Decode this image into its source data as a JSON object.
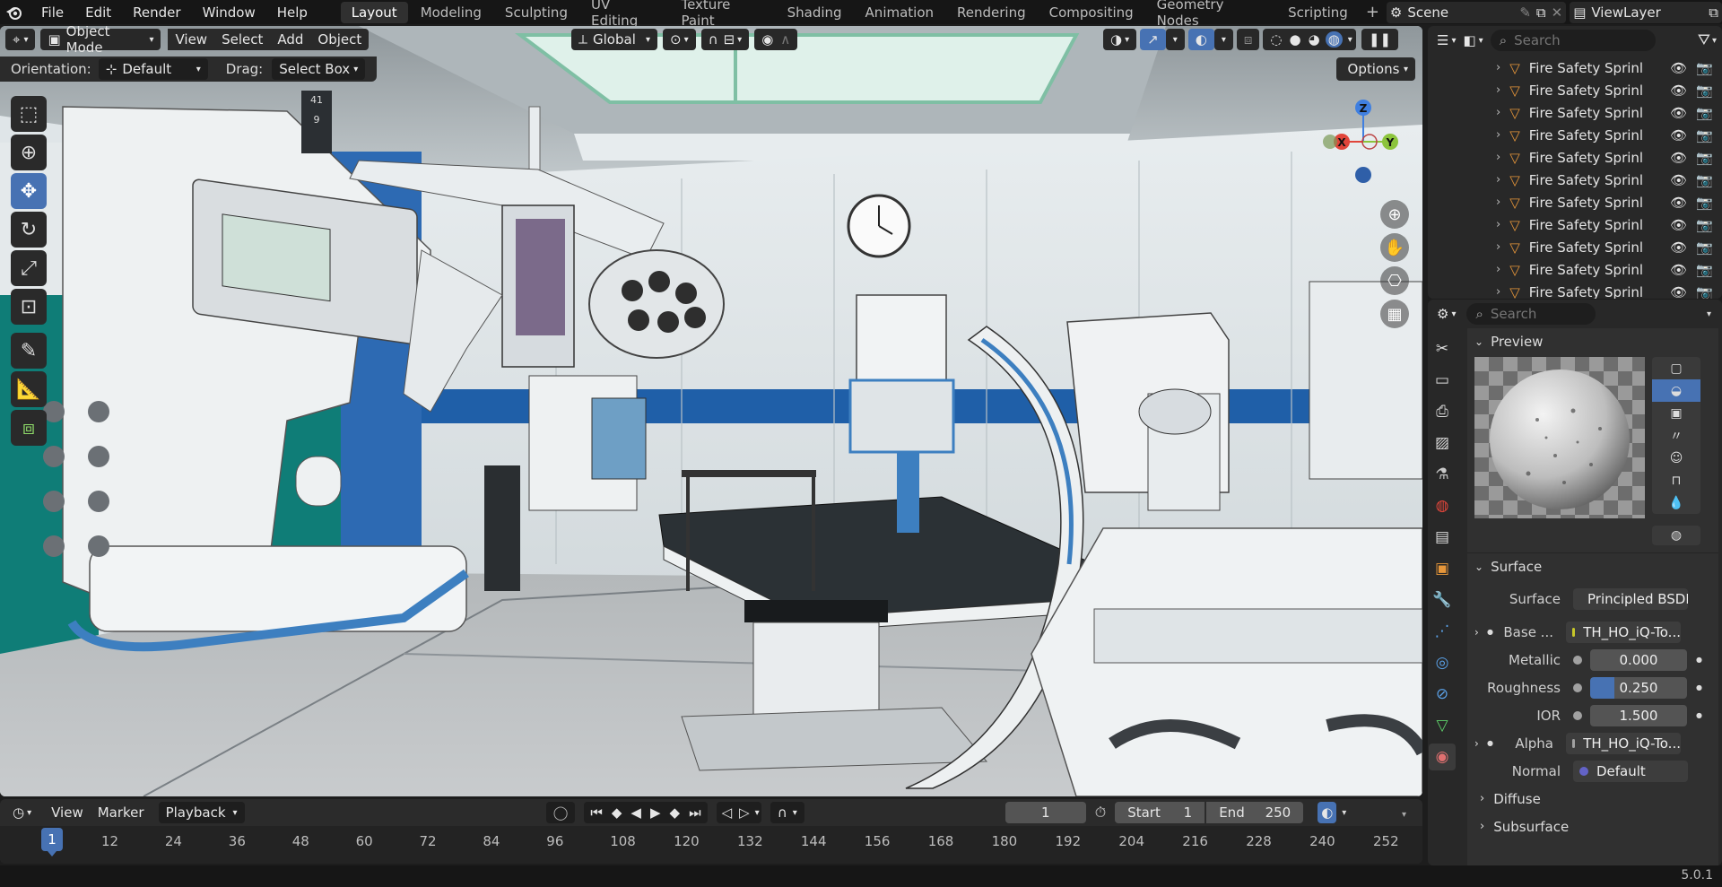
{
  "menu": {
    "items": [
      "File",
      "Edit",
      "Render",
      "Window",
      "Help"
    ]
  },
  "workspaces": [
    "Layout",
    "Modeling",
    "Sculpting",
    "UV Editing",
    "Texture Paint",
    "Shading",
    "Animation",
    "Rendering",
    "Compositing",
    "Geometry Nodes",
    "Scripting"
  ],
  "workspace_add": "+",
  "scene": {
    "label": "Scene"
  },
  "viewlayer": {
    "label": "ViewLayer"
  },
  "viewport": {
    "mode": "Object Mode",
    "menus": [
      "View",
      "Select",
      "Add",
      "Object"
    ],
    "transform_orientation": "Global",
    "orientation_label": "Orientation:",
    "orientation_value": "Default",
    "drag_label": "Drag:",
    "drag_value": "Select Box",
    "options": "Options",
    "gizmo": {
      "z": "Z",
      "x": "X",
      "y": "Y"
    },
    "monitor_numbers": [
      "41",
      "9"
    ]
  },
  "outliner": {
    "search_placeholder": "Search",
    "rows": [
      "Fire Safety Sprinl",
      "Fire Safety Sprinl",
      "Fire Safety Sprinl",
      "Fire Safety Sprinl",
      "Fire Safety Sprinl",
      "Fire Safety Sprinl",
      "Fire Safety Sprinl",
      "Fire Safety Sprinl",
      "Fire Safety Sprinl",
      "Fire Safety Sprinl",
      "Fire Safety Sprinl"
    ]
  },
  "properties": {
    "search_placeholder": "Search",
    "preview_title": "Preview",
    "surface_title": "Surface",
    "fields": {
      "surface": {
        "label": "Surface",
        "value": "Principled BSDF",
        "socket_color": "#63c763"
      },
      "base_color": {
        "label": "Base ...",
        "value": "TH_HO_iQ-To...",
        "socket_color": "#c7c729"
      },
      "metallic": {
        "label": "Metallic",
        "value": "0.000",
        "socket_color": "#a1a1a1"
      },
      "roughness": {
        "label": "Roughness",
        "value": "0.250",
        "fraction": 0.25,
        "socket_color": "#a1a1a1"
      },
      "ior": {
        "label": "IOR",
        "value": "1.500",
        "socket_color": "#a1a1a1"
      },
      "alpha": {
        "label": "Alpha",
        "value": "TH_HO_iQ-To...",
        "socket_color": "#a1a1a1"
      },
      "normal": {
        "label": "Normal",
        "value": "Default",
        "socket_color": "#6363c7"
      }
    },
    "subpanels": [
      "Diffuse",
      "Subsurface"
    ]
  },
  "timeline": {
    "menus": [
      "View",
      "Marker"
    ],
    "playback": "Playback",
    "current_frame": "1",
    "start_label": "Start",
    "start_value": "1",
    "end_label": "End",
    "end_value": "250",
    "ruler": [
      "12",
      "24",
      "36",
      "48",
      "60",
      "72",
      "84",
      "96",
      "108",
      "120",
      "132",
      "144",
      "156",
      "168",
      "180",
      "192",
      "204",
      "216",
      "228",
      "240",
      "252"
    ],
    "playhead": "1"
  },
  "status": {
    "version": "5.0.1"
  },
  "colors": {
    "accent": "#4772b3",
    "x_axis": "#e0453a",
    "y_axis": "#8cc43c",
    "z_axis": "#3f7fe0",
    "object_icon": "#e6963a"
  }
}
